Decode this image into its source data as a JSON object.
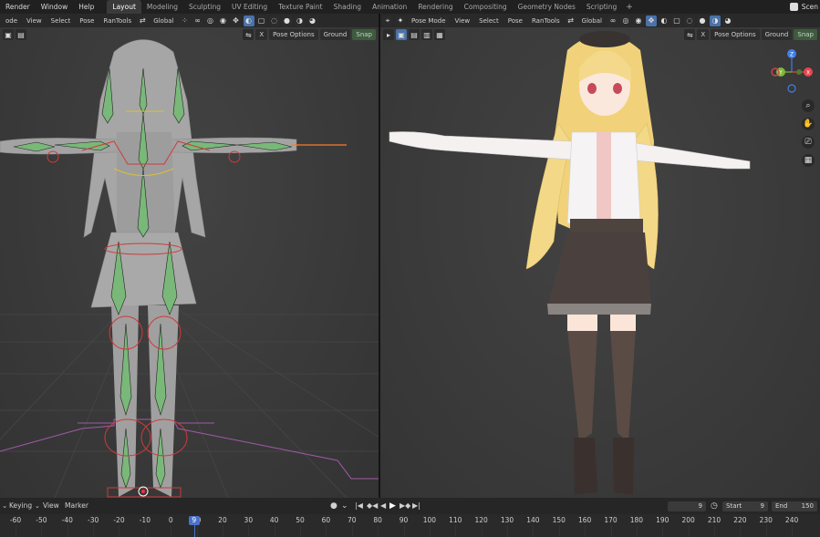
{
  "topbar": {
    "menus": [
      "Render",
      "Window",
      "Help"
    ],
    "workspaces": [
      {
        "label": "Layout",
        "active": true
      },
      {
        "label": "Modeling",
        "active": false
      },
      {
        "label": "Sculpting",
        "active": false
      },
      {
        "label": "UV Editing",
        "active": false
      },
      {
        "label": "Texture Paint",
        "active": false
      },
      {
        "label": "Shading",
        "active": false
      },
      {
        "label": "Animation",
        "active": false
      },
      {
        "label": "Rendering",
        "active": false
      },
      {
        "label": "Compositing",
        "active": false
      },
      {
        "label": "Geometry Nodes",
        "active": false
      },
      {
        "label": "Scripting",
        "active": false
      }
    ],
    "add_tab": "+",
    "scene_label": "Scen"
  },
  "left_viewport": {
    "mode_label": "ode",
    "menus": [
      "View",
      "Select",
      "Pose"
    ],
    "addon_label": "RanTools",
    "transform_label": "Global",
    "x_label": "X",
    "pose_options": "Pose Options",
    "ground_label": "Ground",
    "snap_label": "Snap"
  },
  "right_viewport": {
    "mode_label": "Pose Mode",
    "menus": [
      "View",
      "Select",
      "Pose"
    ],
    "addon_label": "RanTools",
    "transform_label": "Global",
    "x_label": "X",
    "pose_options": "Pose Options",
    "ground_label": "Ground",
    "snap_label": "Snap",
    "gizmo": {
      "x": "X",
      "y": "Y",
      "z": "Z"
    },
    "colors": {
      "x": "#e8454f",
      "y": "#7cb938",
      "z": "#3f7ee6"
    }
  },
  "timeline": {
    "keying_label": "Keying",
    "view_label": "View",
    "marker_label": "Marker",
    "current_frame": "9",
    "start_label": "Start",
    "start_value": "9",
    "end_label": "End",
    "end_value": "150",
    "ticks": [
      "-60",
      "-50",
      "-40",
      "-30",
      "-20",
      "-10",
      "0",
      "10",
      "20",
      "30",
      "40",
      "50",
      "60",
      "70",
      "80",
      "90",
      "100",
      "110",
      "120",
      "130",
      "140",
      "150",
      "160",
      "170",
      "180",
      "190",
      "200",
      "210",
      "220",
      "230",
      "240"
    ],
    "playhead": "9"
  }
}
